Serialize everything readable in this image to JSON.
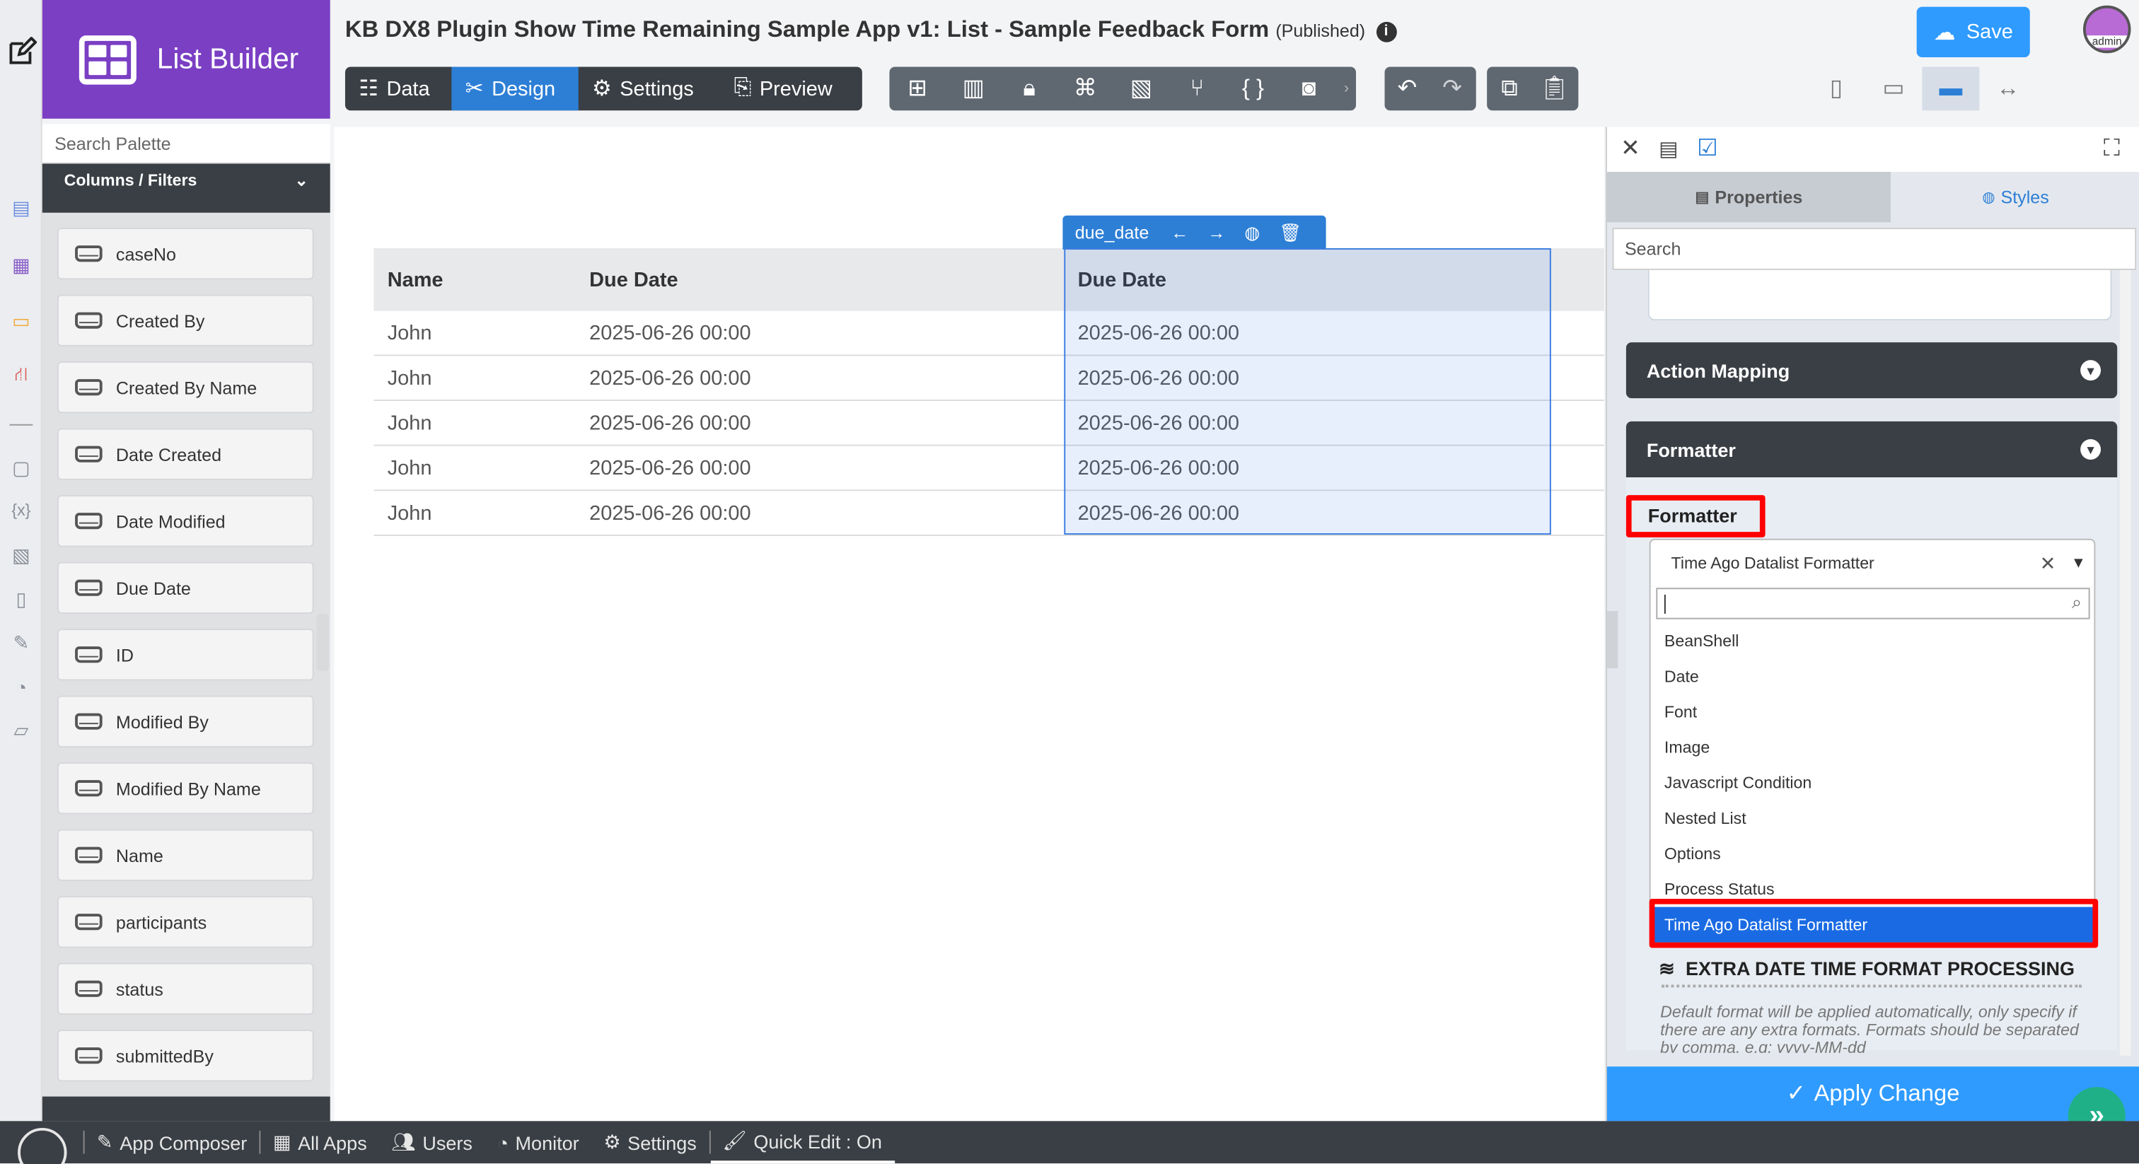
{
  "header": {
    "app_title": "KB DX8 Plugin Show Time Remaining Sample App v1: List - Sample Feedback Form",
    "status": "(Published)",
    "save_label": "Save",
    "avatar_text": "admin"
  },
  "brand": {
    "title": "List Builder"
  },
  "main_tabs": [
    {
      "label": "Data"
    },
    {
      "label": "Design"
    },
    {
      "label": "Settings"
    },
    {
      "label": "Preview"
    }
  ],
  "palette": {
    "search_placeholder": "Search Palette",
    "group_title": "Columns / Filters",
    "fields": [
      "caseNo",
      "Created By",
      "Created By Name",
      "Date Created",
      "Date Modified",
      "Due Date",
      "ID",
      "Modified By",
      "Modified By Name",
      "Name",
      "participants",
      "status",
      "submittedBy"
    ]
  },
  "table": {
    "headers": [
      "Name",
      "Due Date",
      "Due Date"
    ],
    "rows": [
      [
        "John",
        "2025-06-26 00:00",
        "2025-06-26 00:00"
      ],
      [
        "John",
        "2025-06-26 00:00",
        "2025-06-26 00:00"
      ],
      [
        "John",
        "2025-06-26 00:00",
        "2025-06-26 00:00"
      ],
      [
        "John",
        "2025-06-26 00:00",
        "2025-06-26 00:00"
      ],
      [
        "John",
        "2025-06-26 00:00",
        "2025-06-26 00:00"
      ]
    ],
    "selected_column_label": "due_date"
  },
  "properties": {
    "tab_properties": "Properties",
    "tab_styles": "Styles",
    "search_placeholder": "Search",
    "accordion_action_mapping": "Action Mapping",
    "accordion_formatter": "Formatter",
    "formatter_label": "Formatter",
    "formatter_value": "Time Ago Datalist Formatter",
    "options": [
      "BeanShell",
      "Date",
      "Font",
      "Image",
      "Javascript Condition",
      "Nested List",
      "Options",
      "Process Status",
      "Time Ago Datalist Formatter"
    ],
    "extra_heading": "EXTRA DATE TIME FORMAT PROCESSING",
    "extra_text": "Default format will be applied automatically, only specify if there are any extra formats. Formats should be separated by comma, e.g: yyyy-MM-dd",
    "apply_label": "Apply Change"
  },
  "bottom_bar": {
    "items": [
      "App Composer",
      "All Apps",
      "Users",
      "Monitor",
      "Settings",
      "Quick Edit : On"
    ]
  },
  "colors": {
    "brand_purple": "#7b3fc4",
    "accent_blue": "#2d7fd6",
    "highlight_red": "#ff0000",
    "fab_green": "#20b088"
  }
}
